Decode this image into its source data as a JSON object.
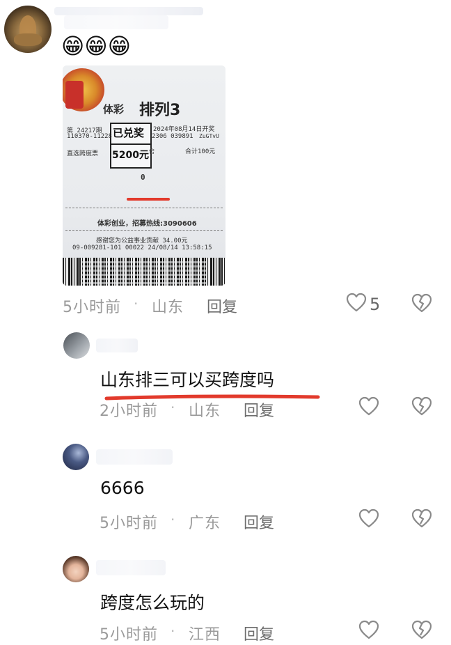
{
  "comments": [
    {
      "emoji": "😁😁😁",
      "meta": {
        "time": "5小时前",
        "location": "山东",
        "reply": "回复"
      },
      "likes": 5,
      "image": {
        "lottery": "体彩",
        "game": "排列3",
        "issue": "第 24217期",
        "date": "2024年08月14日开奖",
        "serial_a": "110370-11228",
        "serial_b": "2306 039891",
        "serial_c": "ZuGTvU",
        "play_type": "直选跨度票",
        "total": "合计100元",
        "stamp_title": "已兑奖",
        "stamp_amount": "5200元",
        "stamp_suffix": "倍",
        "number": "0",
        "hotline": "体彩创业，招募热线:3090606",
        "thanks": "感谢您为公益事业贡献 34.00元",
        "footer": "09-009281-101  00022  24/08/14 13:58:15"
      }
    },
    {
      "text": "山东排三可以买跨度吗",
      "meta": {
        "time": "2小时前",
        "location": "山东",
        "reply": "回复"
      }
    },
    {
      "text": "6666",
      "meta": {
        "time": "5小时前",
        "location": "广东",
        "reply": "回复"
      }
    },
    {
      "text": "跨度怎么玩的",
      "meta": {
        "time": "5小时前",
        "location": "江西",
        "reply": "回复"
      }
    }
  ],
  "icons": {
    "like": "heart-outline-icon",
    "dislike": "broken-heart-outline-icon"
  },
  "colors": {
    "annotation_red": "#e23a2c",
    "meta_gray": "#9a9a9a"
  }
}
